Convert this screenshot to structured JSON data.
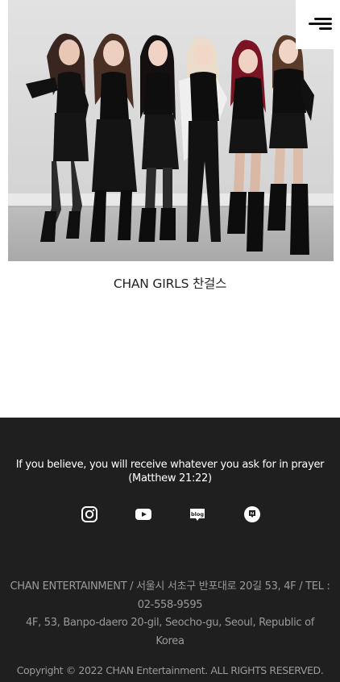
{
  "hero": {
    "image_alt": "CHAN GIRLS group photo",
    "caption": "CHAN GIRLS 찬걸스"
  },
  "menu": {
    "icon": "hamburger-menu-icon"
  },
  "footer": {
    "quote_line1": "If you believe, you will receive whatever you ask for in prayer",
    "quote_line2": "(Matthew 21:22)",
    "socials": [
      {
        "name": "instagram",
        "icon": "instagram-icon"
      },
      {
        "name": "youtube",
        "icon": "youtube-icon"
      },
      {
        "name": "blog",
        "icon": "naver-blog-icon",
        "label": "blog"
      },
      {
        "name": "post",
        "icon": "naver-post-icon"
      }
    ],
    "address_line1": "CHAN ENTERTAINMENT / 서울시 서초구 반포대로 20길 53, 4F / TEL :",
    "address_line2": "02-558-9595",
    "address_line3": "4F, 53, Banpo-daero 20-gil, Seocho-gu, Seoul, Republic of",
    "address_line4": "Korea",
    "copyright": "Copyright © 2022 CHAN Entertainment. ALL RIGHTS RESERVED.",
    "colors": {
      "background": "#1f1f1f",
      "quote_text": "#ffffff",
      "muted_text": "#9a9a9a"
    }
  }
}
